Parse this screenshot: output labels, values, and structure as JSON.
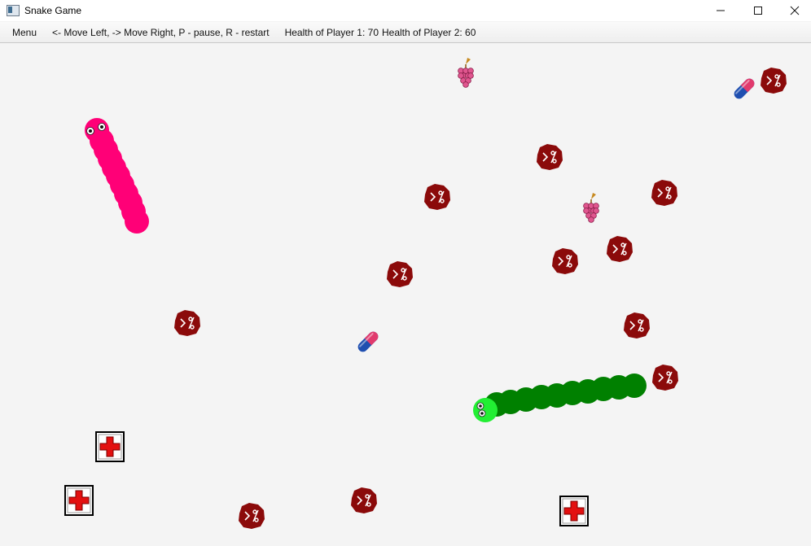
{
  "window": {
    "title": "Snake Game",
    "icon": "app-window-icon",
    "controls": {
      "minimize": "—",
      "maximize": "☐",
      "close": "✕"
    }
  },
  "menubar": {
    "menu_label": "Menu",
    "controls_hint": "<- Move Left, -> Move Right, P - pause, R - restart",
    "health_p1": "Health of Player 1: 70",
    "health_p2": "Health of Player 2: 60"
  },
  "game": {
    "players": [
      {
        "id": 1,
        "health": 70,
        "color": "#ff0077"
      },
      {
        "id": 2,
        "health": 60,
        "color": "#008000",
        "head_color": "#22ee33"
      }
    ],
    "rock_color": "#8b0a0a",
    "item_icons": [
      "grape-icon",
      "pill-icon",
      "angry-rock-icon",
      "medkit-icon"
    ]
  }
}
